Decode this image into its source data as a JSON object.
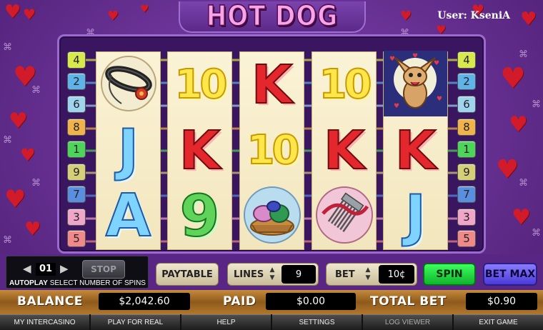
{
  "header": {
    "title": "HOT DOG",
    "user_label": "User: KseniA"
  },
  "reels": [
    [
      {
        "type": "image",
        "icon": "dog-collar-icon"
      },
      {
        "type": "text",
        "value": "J",
        "cls": "sym-J"
      },
      {
        "type": "text",
        "value": "A",
        "cls": "sym-A"
      }
    ],
    [
      {
        "type": "text",
        "value": "10",
        "cls": "sym-10"
      },
      {
        "type": "text",
        "value": "K",
        "cls": "sym-K"
      },
      {
        "type": "text",
        "value": "9",
        "cls": "sym-9"
      }
    ],
    [
      {
        "type": "text",
        "value": "K",
        "cls": "sym-K"
      },
      {
        "type": "text",
        "value": "10",
        "cls": "sym-10"
      },
      {
        "type": "image",
        "icon": "dog-bed-icon"
      }
    ],
    [
      {
        "type": "text",
        "value": "10",
        "cls": "sym-10"
      },
      {
        "type": "text",
        "value": "K",
        "cls": "sym-K"
      },
      {
        "type": "image",
        "icon": "grooming-comb-icon"
      }
    ],
    [
      {
        "type": "image",
        "icon": "chihuahua-wild-icon"
      },
      {
        "type": "text",
        "value": "K",
        "cls": "sym-K"
      },
      {
        "type": "text",
        "value": "J",
        "cls": "sym-J"
      }
    ]
  ],
  "paylines": {
    "left": [
      "4",
      "2",
      "6",
      "8",
      "1",
      "9",
      "7",
      "3",
      "5"
    ],
    "right": [
      "4",
      "2",
      "6",
      "8",
      "1",
      "9",
      "7",
      "3",
      "5"
    ],
    "colors": {
      "4": "#d9e84a",
      "2": "#5fb3e8",
      "6": "#9fd3ee",
      "8": "#f0b24a",
      "1": "#4ed45a",
      "9": "#d6cf7a",
      "7": "#5a8fe0",
      "3": "#f0a6c8",
      "5": "#f08a8a"
    }
  },
  "autoplay": {
    "spins": "01",
    "stop_label": "STOP",
    "label_bold": "AUTOPLAY",
    "label_rest": "SELECT NUMBER OF SPINS"
  },
  "controls": {
    "paytable_label": "PAYTABLE",
    "lines_label": "LINES",
    "lines_value": "9",
    "bet_label": "BET",
    "bet_value": "10¢",
    "spin_label": "SPIN",
    "betmax_label": "BET MAX"
  },
  "balance": {
    "balance_label": "BALANCE",
    "balance_value": "$2,042.60",
    "paid_label": "PAID",
    "paid_value": "$0.00",
    "total_bet_label": "TOTAL BET",
    "total_bet_value": "$0.90"
  },
  "nav": [
    "MY INTERCASINO",
    "PLAY FOR REAL",
    "HELP",
    "SETTINGS",
    "LOG VIEWER",
    "EXIT GAME"
  ]
}
